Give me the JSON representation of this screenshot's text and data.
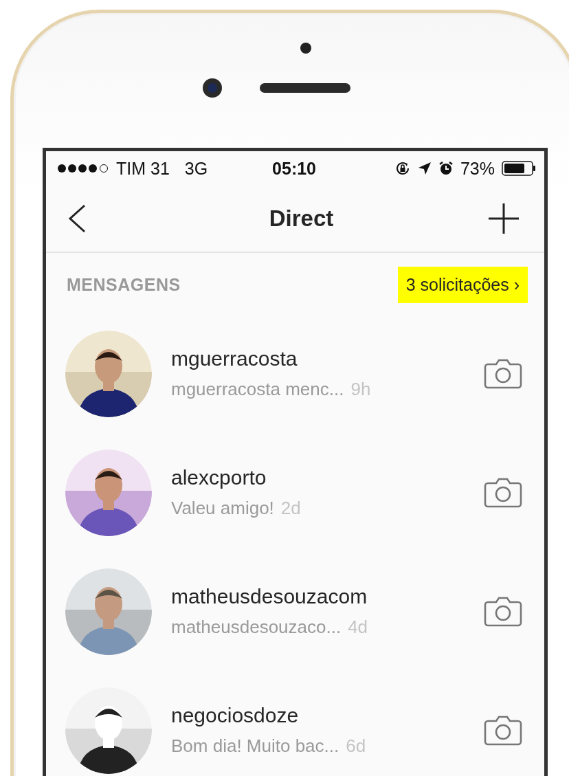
{
  "status_bar": {
    "carrier": "TIM 31",
    "network": "3G",
    "time": "05:10",
    "battery_percent": "73%"
  },
  "nav_bar": {
    "title": "Direct"
  },
  "section": {
    "title": "MENSAGENS",
    "requests_link": "3 solicitações ›"
  },
  "conversations": [
    {
      "username": "mguerracosta",
      "preview": "mguerracosta menc...",
      "time": "9h"
    },
    {
      "username": "alexcporto",
      "preview": "Valeu amigo!",
      "time": "2d"
    },
    {
      "username": "matheusdesouzacom",
      "preview": "matheusdesouzaco...",
      "time": "4d"
    },
    {
      "username": "negociosdoze",
      "preview": "Bom dia! Muito bac...",
      "time": "6d"
    }
  ]
}
